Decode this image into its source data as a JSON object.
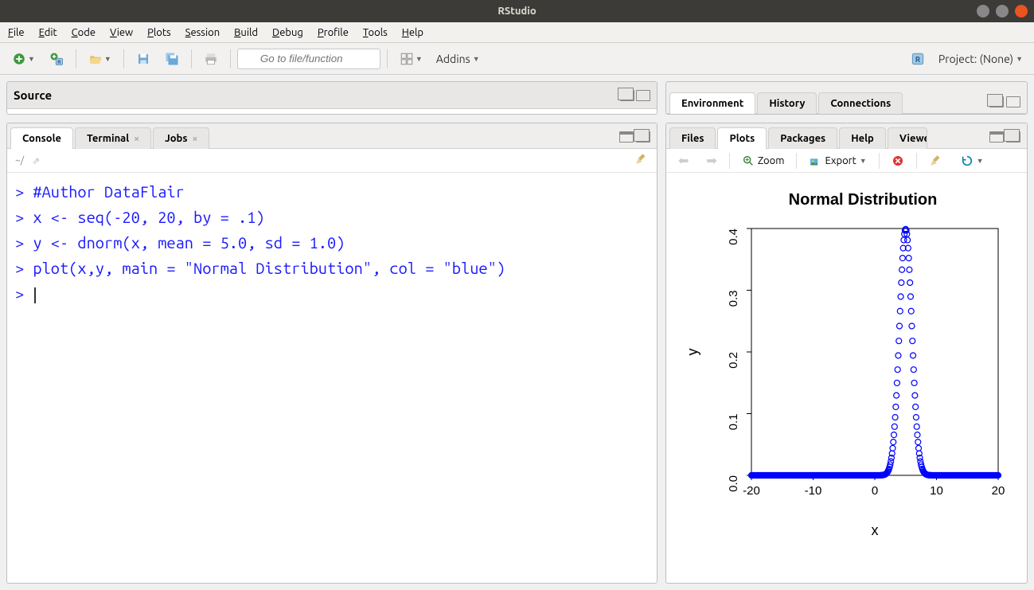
{
  "window": {
    "title": "RStudio"
  },
  "menubar": [
    "File",
    "Edit",
    "Code",
    "View",
    "Plots",
    "Session",
    "Build",
    "Debug",
    "Profile",
    "Tools",
    "Help"
  ],
  "toolbar": {
    "goto_placeholder": "Go to file/function",
    "addins_label": "Addins",
    "project_label": "Project: (None)"
  },
  "panes": {
    "source_label": "Source",
    "console_tabs": [
      {
        "label": "Console",
        "active": true,
        "closable": false
      },
      {
        "label": "Terminal",
        "active": false,
        "closable": true
      },
      {
        "label": "Jobs",
        "active": false,
        "closable": true
      }
    ],
    "console_path": "~/",
    "env_tabs": [
      {
        "label": "Environment"
      },
      {
        "label": "History"
      },
      {
        "label": "Connections"
      }
    ],
    "br_tabs": [
      {
        "label": "Files",
        "active": false
      },
      {
        "label": "Plots",
        "active": true
      },
      {
        "label": "Packages",
        "active": false
      },
      {
        "label": "Help",
        "active": false
      },
      {
        "label": "Viewer",
        "active": false
      }
    ],
    "plot_toolbar": {
      "zoom": "Zoom",
      "export": "Export"
    }
  },
  "console": {
    "lines": [
      "#Author DataFlair",
      "x <- seq(-20, 20, by = .1)",
      "y <- dnorm(x, mean = 5.0, sd = 1.0)",
      "plot(x,y, main = \"Normal Distribution\", col = \"blue\")"
    ]
  },
  "chart_data": {
    "type": "scatter",
    "title": "Normal Distribution",
    "xlabel": "x",
    "ylabel": "y",
    "xlim": [
      -20,
      20
    ],
    "ylim": [
      0,
      0.4
    ],
    "xticks": [
      -20,
      -10,
      0,
      10,
      20
    ],
    "yticks": [
      0.0,
      0.1,
      0.2,
      0.3,
      0.4
    ],
    "series": [
      {
        "name": "dnorm(mean=5,sd=1)",
        "color": "blue",
        "x_generator": "seq(-20,20,by=0.1)",
        "y_generator": "dnorm(x,mean=5,sd=1)",
        "peak_x": 5,
        "peak_y": 0.3989
      }
    ]
  }
}
